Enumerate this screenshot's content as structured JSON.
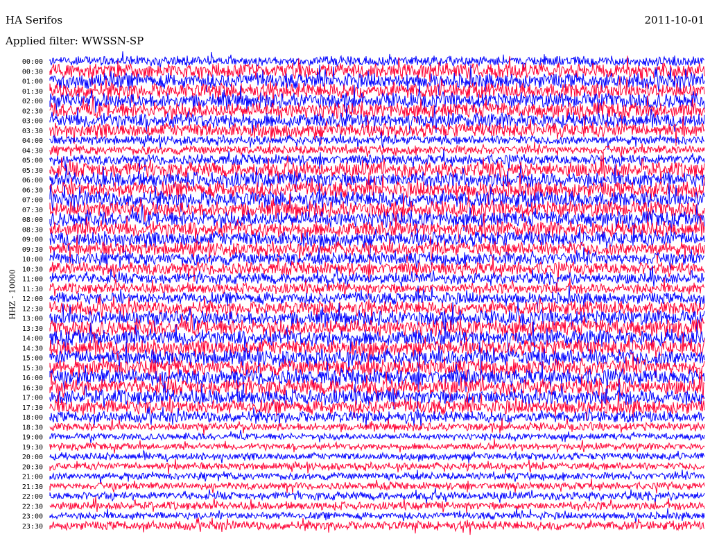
{
  "header": {
    "station": "HA Serifos",
    "filter": "Applied filter: WWSSN-SP",
    "date": "2011-10-01"
  },
  "axis": {
    "ylabel": "HHZ - 10000"
  },
  "colors": {
    "even_trace": "#0000ff",
    "odd_trace": "#ff0033",
    "background": "#ffffff"
  },
  "chart_data": {
    "type": "line",
    "title": "HA Serifos",
    "subtitle": "Applied filter: WWSSN-SP",
    "ylabel": "HHZ - 10000",
    "xlabel": "",
    "grid": false,
    "legend": "none",
    "tick_labels": [
      "00:00",
      "00:30",
      "01:00",
      "01:30",
      "02:00",
      "02:30",
      "03:00",
      "03:30",
      "04:00",
      "04:30",
      "05:00",
      "05:30",
      "06:00",
      "06:30",
      "07:00",
      "07:30",
      "08:00",
      "08:30",
      "09:00",
      "09:30",
      "10:00",
      "10:30",
      "11:00",
      "11:30",
      "12:00",
      "12:30",
      "13:00",
      "13:30",
      "14:00",
      "14:30",
      "15:00",
      "15:30",
      "16:00",
      "16:30",
      "17:00",
      "17:30",
      "18:00",
      "18:30",
      "19:00",
      "19:30",
      "20:00",
      "20:30",
      "21:00",
      "21:30",
      "22:00",
      "22:30",
      "23:00",
      "23:30"
    ],
    "relative_amplitude": [
      0.62,
      0.95,
      0.95,
      0.95,
      0.95,
      0.95,
      0.9,
      0.9,
      0.55,
      0.55,
      0.65,
      0.95,
      0.95,
      1.0,
      1.0,
      1.0,
      0.95,
      0.95,
      0.95,
      0.85,
      0.8,
      0.8,
      0.7,
      0.65,
      0.75,
      0.85,
      0.95,
      1.0,
      1.0,
      1.0,
      1.0,
      1.0,
      1.0,
      1.0,
      0.95,
      0.9,
      0.7,
      0.5,
      0.4,
      0.4,
      0.45,
      0.45,
      0.45,
      0.45,
      0.5,
      0.5,
      0.45,
      0.55
    ]
  }
}
